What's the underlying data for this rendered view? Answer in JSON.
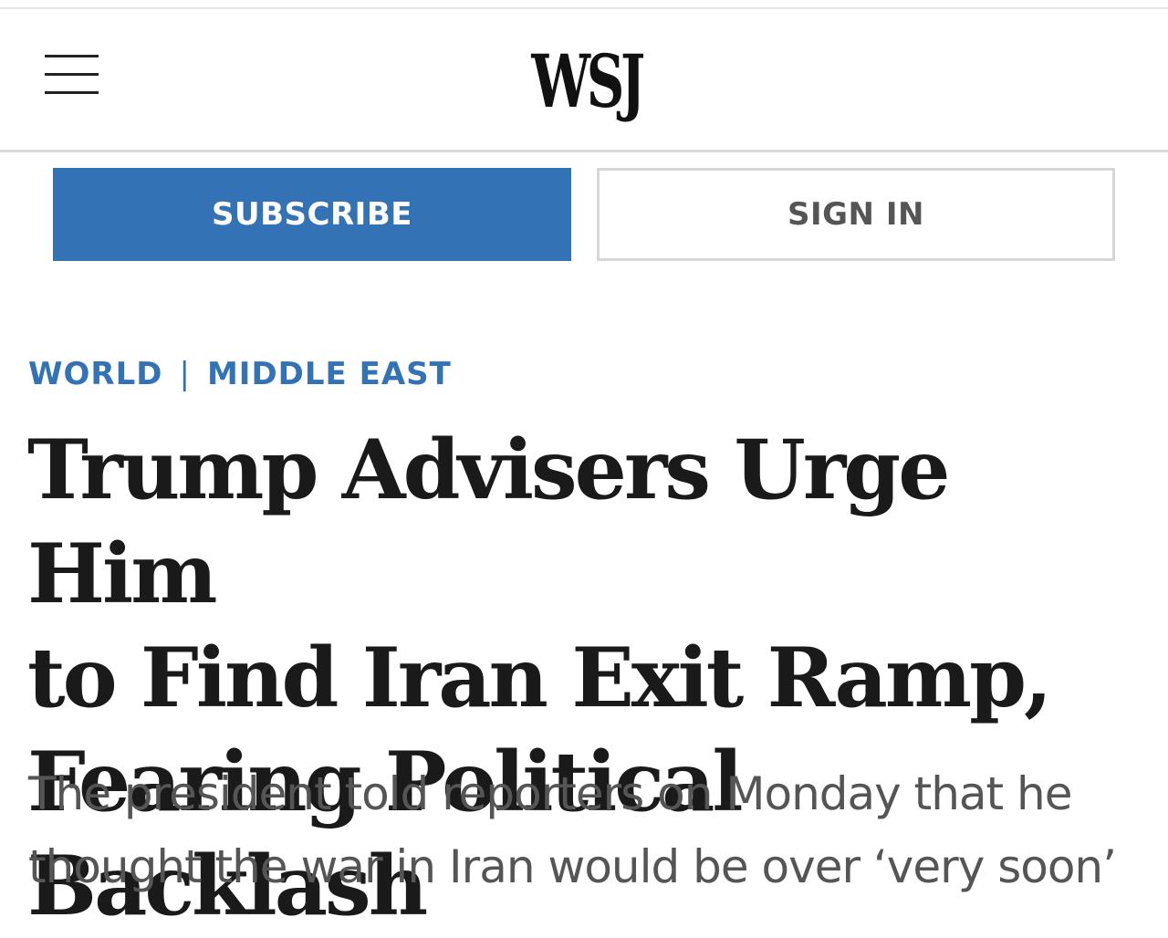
{
  "header": {
    "logo_text": "WSJ",
    "menu_icon": "hamburger-menu-icon"
  },
  "actions": {
    "subscribe_label": "SUBSCRIBE",
    "signin_label": "SIGN IN"
  },
  "article": {
    "section": "WORLD",
    "section_separator": "|",
    "subsection": "MIDDLE EAST",
    "headline_lines": [
      "Trump Advisers Urge Him",
      "to Find Iran Exit Ramp,",
      "Fearing Political Backlash"
    ],
    "dek_lines": [
      "The president told reporters on Monday that he",
      "thought the war in Iran would be over ‘very soon’"
    ]
  },
  "colors": {
    "accent_blue": "#3373b5",
    "headline_text": "#1a1a1a",
    "dek_text": "#555555",
    "border_gray": "#d6d6d6"
  }
}
